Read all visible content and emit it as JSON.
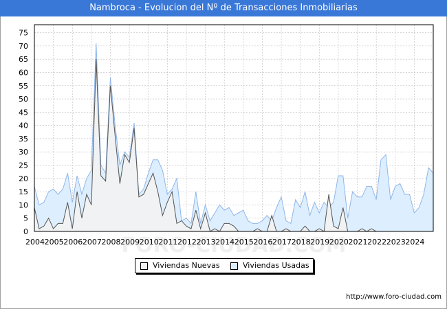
{
  "title": "Nambroca - Evolucion del Nº de Transacciones Inmobiliarias",
  "source": "http://www.foro-ciudad.com",
  "watermark": "FORO-CIUDAD.COM",
  "legend": {
    "nuevas": "Viviendas Nuevas",
    "usadas": "Viviendas Usadas"
  },
  "colors": {
    "title_bg": "#3a78d8",
    "nuevas_fill": "#f2f2f2",
    "nuevas_line": "#555555",
    "usadas_fill": "#ddeeff",
    "usadas_line": "#8fb6e8",
    "grid": "#bbbbbb"
  },
  "chart_data": {
    "type": "area",
    "title": "Nambroca - Evolucion del Nº de Transacciones Inmobiliarias",
    "x_tick_labels": [
      "2004",
      "2005",
      "2006",
      "2007",
      "2008",
      "2009",
      "2010",
      "2011",
      "2012",
      "2013",
      "2014",
      "2015",
      "2016",
      "2017",
      "2018",
      "2019",
      "2020",
      "2021",
      "2022",
      "2023",
      "2024"
    ],
    "x_start_year": 2004,
    "points_per_year": 4,
    "ylim": [
      0,
      78
    ],
    "y_ticks": [
      0,
      5,
      10,
      15,
      20,
      25,
      30,
      35,
      40,
      45,
      50,
      55,
      60,
      65,
      70,
      75
    ],
    "grid": true,
    "legend_position": "bottom",
    "series": [
      {
        "name": "Viviendas Nuevas",
        "values": [
          9,
          1,
          2,
          5,
          1,
          3,
          3,
          11,
          1,
          15,
          5,
          14,
          10,
          65,
          21,
          19,
          55,
          36,
          18,
          29,
          26,
          39,
          13,
          14,
          18,
          22,
          15,
          6,
          11,
          15,
          3,
          4,
          2,
          1,
          8,
          1,
          7,
          0,
          1,
          0,
          3,
          3,
          2,
          0,
          0,
          0,
          0,
          1,
          0,
          0,
          6,
          0,
          0,
          1,
          0,
          0,
          0,
          2,
          0,
          0,
          1,
          0,
          14,
          2,
          1,
          9,
          0,
          0,
          0,
          1,
          0,
          1,
          0,
          0,
          0,
          0,
          0,
          0,
          0,
          0,
          0,
          0,
          0,
          0
        ]
      },
      {
        "name": "Viviendas Usadas",
        "values": [
          17,
          10,
          11,
          15,
          16,
          14,
          16,
          22,
          11,
          21,
          14,
          20,
          23,
          71,
          25,
          22,
          58,
          40,
          25,
          30,
          28,
          41,
          14,
          16,
          22,
          27,
          27,
          23,
          14,
          16,
          20,
          4,
          5,
          3,
          15,
          3,
          10,
          4,
          7,
          10,
          8,
          9,
          6,
          7,
          8,
          4,
          3,
          3,
          4,
          6,
          4,
          9,
          13,
          4,
          3,
          12,
          9,
          15,
          6,
          11,
          7,
          11,
          9,
          11,
          21,
          21,
          5,
          15,
          13,
          13,
          17,
          17,
          12,
          27,
          29,
          12,
          17,
          18,
          14,
          14,
          7,
          9,
          14,
          24,
          22
        ]
      }
    ]
  }
}
